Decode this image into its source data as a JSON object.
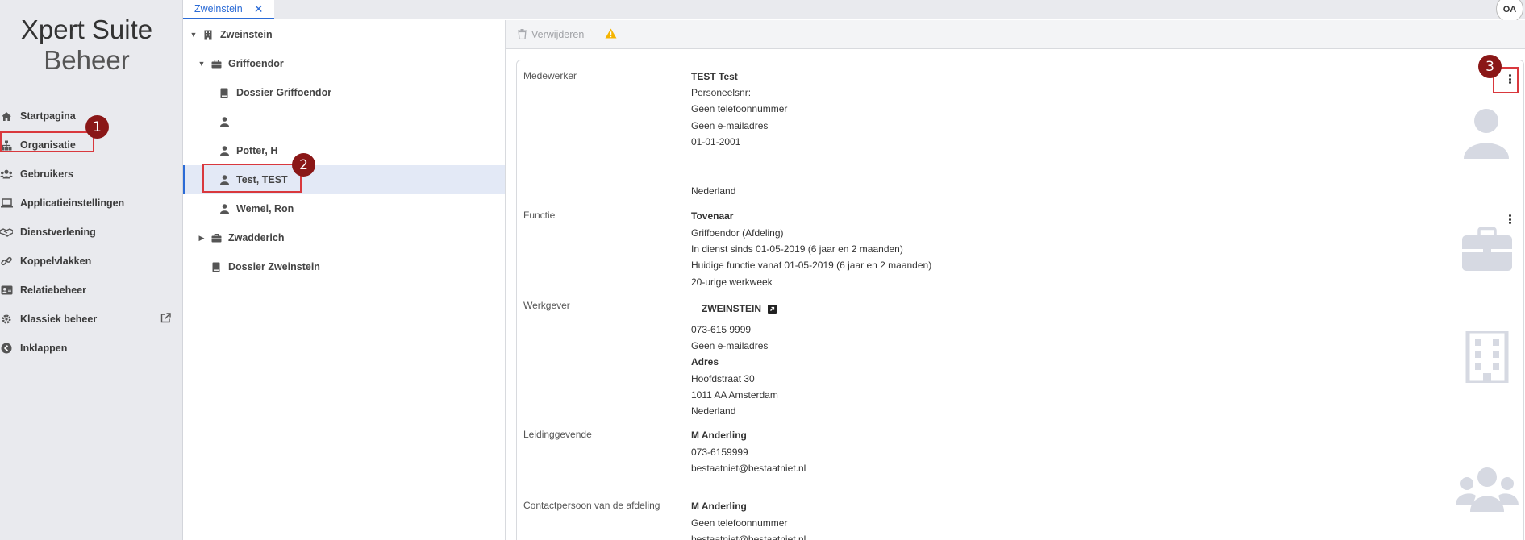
{
  "app": {
    "title_line1": "Xpert Suite",
    "title_line2": "Beheer"
  },
  "sidebar": {
    "items": [
      {
        "label": "Startpagina",
        "icon": "home-icon"
      },
      {
        "label": "Organisatie",
        "icon": "sitemap-icon"
      },
      {
        "label": "Gebruikers",
        "icon": "users-icon"
      },
      {
        "label": "Applicatieinstellingen",
        "icon": "laptop-icon"
      },
      {
        "label": "Dienstverlening",
        "icon": "handshake-icon"
      },
      {
        "label": "Koppelvlakken",
        "icon": "link-icon"
      },
      {
        "label": "Relatiebeheer",
        "icon": "id-card-icon"
      },
      {
        "label": "Klassiek beheer",
        "icon": "gear-icon"
      },
      {
        "label": "Inklappen",
        "icon": "chevron-left-circle-icon"
      }
    ]
  },
  "tabs": [
    {
      "label": "Zweinstein",
      "close": "✕"
    }
  ],
  "user": {
    "initials": "OA"
  },
  "tree": [
    {
      "label": "Zweinstein",
      "icon": "building-icon"
    },
    {
      "label": "Griffoendor",
      "icon": "briefcase-icon"
    },
    {
      "label": "Dossier Griffoendor",
      "icon": "book-icon"
    },
    {
      "label": "",
      "icon": "user-icon"
    },
    {
      "label": "Potter, H",
      "icon": "user-icon"
    },
    {
      "label": "Test, TEST",
      "icon": "user-icon"
    },
    {
      "label": "Wemel, Ron",
      "icon": "user-icon"
    },
    {
      "label": "Zwadderich",
      "icon": "briefcase-icon"
    },
    {
      "label": "Dossier Zweinstein",
      "icon": "book-icon"
    }
  ],
  "toolbar": {
    "delete_label": "Verwijderen"
  },
  "detail": {
    "medewerker": {
      "label": "Medewerker",
      "name": "TEST Test",
      "personeelsnr": "Personeelsnr:",
      "phone": "Geen telefoonnummer",
      "email": "Geen e-mailadres",
      "date": "01-01-2001",
      "country": "Nederland"
    },
    "functie": {
      "label": "Functie",
      "title": "Tovenaar",
      "department": "Griffoendor (Afdeling)",
      "in_dienst": "In dienst sinds 01-05-2019 (6 jaar en 2 maanden)",
      "huidige": "Huidige functie vanaf 01-05-2019 (6 jaar en 2 maanden)",
      "hours": "20-urige werkweek"
    },
    "werkgever": {
      "label": "Werkgever",
      "name": "ZWEINSTEIN",
      "phone": "073-615 9999",
      "email": "Geen e-mailadres",
      "address_label": "Adres",
      "street": "Hoofdstraat 30",
      "city": "1011 AA Amsterdam",
      "country": "Nederland"
    },
    "leidinggevende": {
      "label": "Leidinggevende",
      "name": "M Anderling",
      "phone": "073-6159999",
      "email": "bestaatniet@bestaatniet.nl"
    },
    "contactpersoon": {
      "label": "Contactpersoon van de afdeling",
      "name": "M Anderling",
      "phone": "Geen telefoonnummer",
      "email": "bestaatniet@bestaatniet.nl"
    }
  },
  "callouts": [
    "1",
    "2",
    "3"
  ],
  "colors": {
    "accent": "#2b6bd6",
    "callout": "#8a1717",
    "highlight": "#d9383d",
    "warning": "#f5b400"
  }
}
